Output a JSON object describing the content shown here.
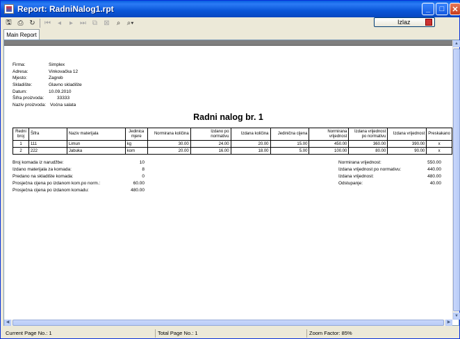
{
  "window": {
    "title": "Report: RadniNalog1.rpt"
  },
  "toolbar": {
    "icons": [
      "export-icon",
      "print-icon",
      "refresh-icon",
      "first-page-icon",
      "prev-page-icon",
      "next-page-icon",
      "last-page-icon",
      "goto-page-icon",
      "close-view-icon",
      "find-icon",
      "zoom-icon"
    ],
    "izlaz_label": "Izlaz"
  },
  "tabs": [
    {
      "label": "Main Report"
    }
  ],
  "report": {
    "info": [
      {
        "key": "Firma:",
        "value": "Simplex"
      },
      {
        "key": "Adresa:",
        "value": "Vinkovačka 12"
      },
      {
        "key": "Mjesto:",
        "value": "Zagreb"
      },
      {
        "key": "Skladište:",
        "value": "Glavno skladište"
      },
      {
        "key": "Datum:",
        "value": "10.09.2010"
      },
      {
        "key": "Šifra proizvoda:",
        "value": "33333"
      },
      {
        "key": "Naziv proizvoda:",
        "value": "Voćna salata"
      }
    ],
    "title": "Radni nalog br.  1",
    "columns": [
      "Redni broj",
      "Šifra",
      "Naziv materijala",
      "Jedinica mjere",
      "Normirana količina",
      "Izdano po normativu",
      "Izdana količina",
      "Jedinična cijena",
      "Normirana vrijednost",
      "Izdana vrijednost po normativu",
      "Izdana vrijednost",
      "Preskakano"
    ],
    "rows": [
      [
        "1",
        "111",
        "Limun",
        "kg",
        "30.00",
        "24.00",
        "20.00",
        "15.00",
        "450.00",
        "360.00",
        "390.00",
        "x"
      ],
      [
        "2",
        "222",
        "Jabuka",
        "kom",
        "20.00",
        "16.00",
        "18.00",
        "5.00",
        "100.00",
        "80.00",
        "90.00",
        "x"
      ]
    ],
    "summary_left": [
      {
        "key": "Broj komada iz narudžbe:",
        "value": "10"
      },
      {
        "key": "Izdano materijala za komada:",
        "value": "8"
      },
      {
        "key": "Predano na skladište komada:",
        "value": "0"
      },
      {
        "key": "Prosječna cijena po izdanom kom.po norm.:",
        "value": "60.00"
      },
      {
        "key": "Prosječna cijena po izdanom komadu:",
        "value": "480.00"
      }
    ],
    "summary_right": [
      {
        "key": "Normirana vrijednost:",
        "value": "550.00"
      },
      {
        "key": "Izdana vrijednost po normativu:",
        "value": "440.00"
      },
      {
        "key": "Izdana vrijednost:",
        "value": "480.00"
      },
      {
        "key": "Odstupanje:",
        "value": "40.00"
      }
    ]
  },
  "status": {
    "current_page": "Current Page No.: 1",
    "total_page": "Total Page No.: 1",
    "zoom": "Zoom Factor: 85%"
  }
}
